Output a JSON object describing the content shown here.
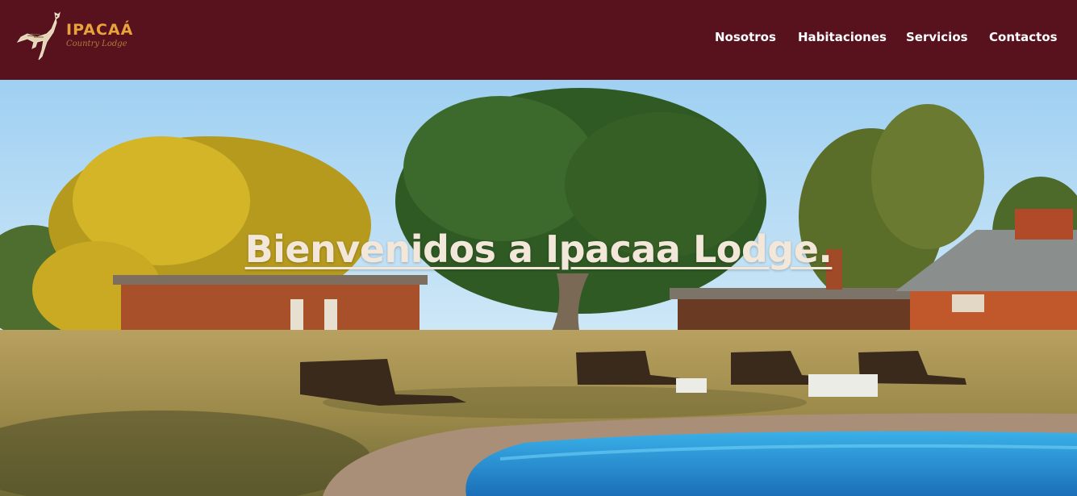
{
  "brand": {
    "name": "IPACAÁ",
    "tagline": "Country Lodge",
    "logo_icon": "bird-icon"
  },
  "nav": {
    "items": [
      {
        "label": "Nosotros"
      },
      {
        "label": "Habitaciones"
      },
      {
        "label": "Servicios"
      },
      {
        "label": "Contactos"
      }
    ]
  },
  "hero": {
    "title": "Bienvenidos a Ipacaa Lodge."
  },
  "colors": {
    "header_bg": "#58121d",
    "brand_accent": "#e8a33c",
    "nav_text": "#ffffff",
    "hero_title": "#f3e7d9"
  }
}
